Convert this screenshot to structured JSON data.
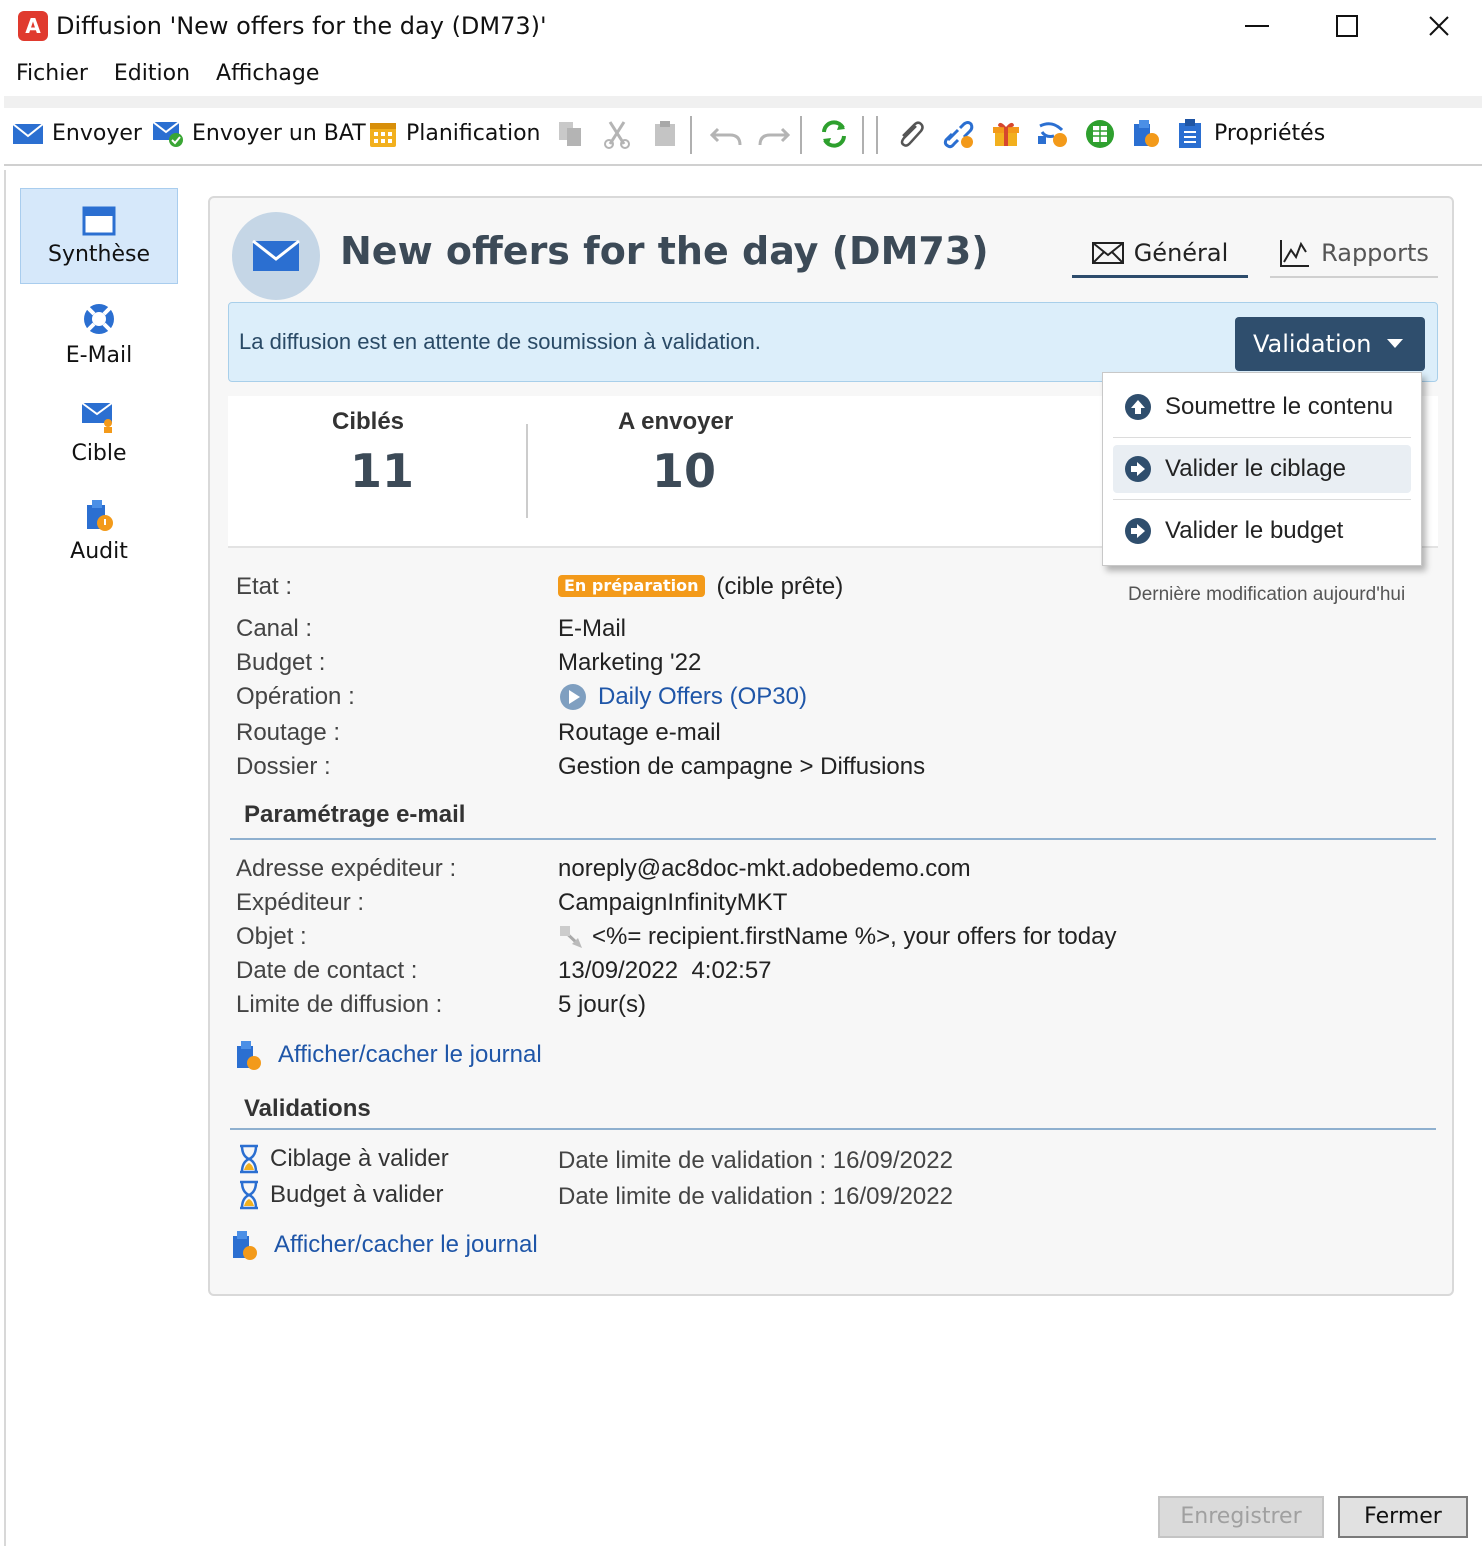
{
  "window": {
    "title": "Diffusion 'New offers for the day (DM73)'"
  },
  "menu": [
    "Fichier",
    "Edition",
    "Affichage"
  ],
  "toolbar": {
    "send": "Envoyer",
    "send_proof": "Envoyer un BAT",
    "schedule": "Planification",
    "properties": "Propriétés"
  },
  "nav": {
    "synthese": "Synthèse",
    "email": "E-Mail",
    "cible": "Cible",
    "audit": "Audit"
  },
  "header": {
    "title": "New offers for the day (DM73)",
    "tab_general": "Général",
    "tab_rapports": "Rapports"
  },
  "banner": {
    "message": "La diffusion est en attente de soumission à validation.",
    "validation_button": "Validation"
  },
  "dropdown": {
    "items": [
      "Soumettre le contenu",
      "Valider le ciblage",
      "Valider le budget"
    ]
  },
  "stats": {
    "targeted_label": "Ciblés",
    "targeted_value": "11",
    "to_send_label": "A envoyer",
    "to_send_value": "10"
  },
  "details": {
    "etat_label": "Etat :",
    "etat_badge": "En préparation",
    "etat_value": "(cible prête)",
    "last_modified": "Dernière modification aujourd'hui",
    "canal_label": "Canal :",
    "canal_value": "E-Mail",
    "budget_label": "Budget :",
    "budget_value": "Marketing '22",
    "operation_label": "Opération :",
    "operation_value": "Daily Offers (OP30)",
    "routage_label": "Routage :",
    "routage_value": "Routage e-mail",
    "dossier_label": "Dossier :",
    "dossier_value": "Gestion de campagne > Diffusions"
  },
  "email_settings": {
    "section_title": "Paramétrage e-mail",
    "sender_address_label": "Adresse expéditeur :",
    "sender_address_value": "noreply@ac8doc-mkt.adobedemo.com",
    "sender_label": "Expéditeur :",
    "sender_value": "CampaignInfinityMKT",
    "subject_label": "Objet :",
    "subject_value": "<%= recipient.firstName %>, your offers for today",
    "contact_date_label": "Date de contact :",
    "contact_date_value": "13/09/2022  4:02:57",
    "limit_label": "Limite de diffusion :",
    "limit_value": "5 jour(s)",
    "journal_link": "Afficher/cacher le journal"
  },
  "validations": {
    "section_title": "Validations",
    "items": [
      {
        "label": "Ciblage à valider",
        "deadline": "Date limite de validation : 16/09/2022"
      },
      {
        "label": "Budget à valider",
        "deadline": "Date limite de validation : 16/09/2022"
      }
    ],
    "journal_link": "Afficher/cacher le journal"
  },
  "buttons": {
    "save": "Enregistrer",
    "close": "Fermer"
  },
  "colors": {
    "accent": "#2f4e6d",
    "banner_bg": "#dceefa",
    "badge": "#f39a1a",
    "link": "#1f56a8"
  }
}
